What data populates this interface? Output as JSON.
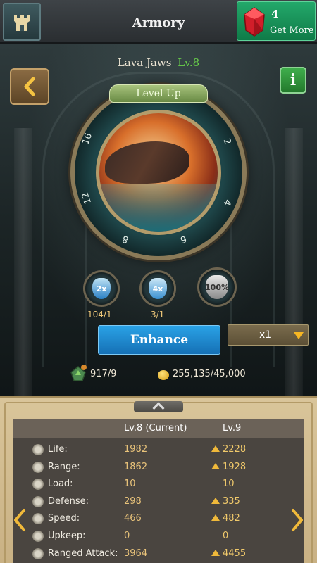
{
  "header": {
    "title": "Armory",
    "gems_count": "4",
    "gems_label": "Get More"
  },
  "item": {
    "name": "Lava Jaws",
    "level": "Lv.8",
    "level_up_label": "Level Up",
    "wheel_numbers": [
      "2",
      "4",
      "6",
      "8",
      "12",
      "16"
    ]
  },
  "potions": [
    {
      "label": "2x",
      "count": "104/1"
    },
    {
      "label": "4x",
      "count": "3/1"
    },
    {
      "label": "100%",
      "count": ""
    }
  ],
  "actions": {
    "enhance_label": "Enhance",
    "multiplier_value": "x1"
  },
  "resources": {
    "stones": "917/9",
    "gold": "255,135/45,000"
  },
  "table": {
    "col_current": "Lv.8 (Current)",
    "col_next": "Lv.9",
    "rows": [
      {
        "label": "Life:",
        "current": "1982",
        "next": "2228",
        "up": true
      },
      {
        "label": "Range:",
        "current": "1862",
        "next": "1928",
        "up": true
      },
      {
        "label": "Load:",
        "current": "10",
        "next": "10",
        "up": false
      },
      {
        "label": "Defense:",
        "current": "298",
        "next": "335",
        "up": true
      },
      {
        "label": "Speed:",
        "current": "466",
        "next": "482",
        "up": true
      },
      {
        "label": "Upkeep:",
        "current": "0",
        "next": "0",
        "up": false
      },
      {
        "label": "Ranged Attack:",
        "current": "3964",
        "next": "4455",
        "up": true
      }
    ]
  },
  "colors": {
    "accent_green": "#69d14a",
    "enhance_blue": "#1f8ad0",
    "gold_text": "#e9c37a"
  }
}
